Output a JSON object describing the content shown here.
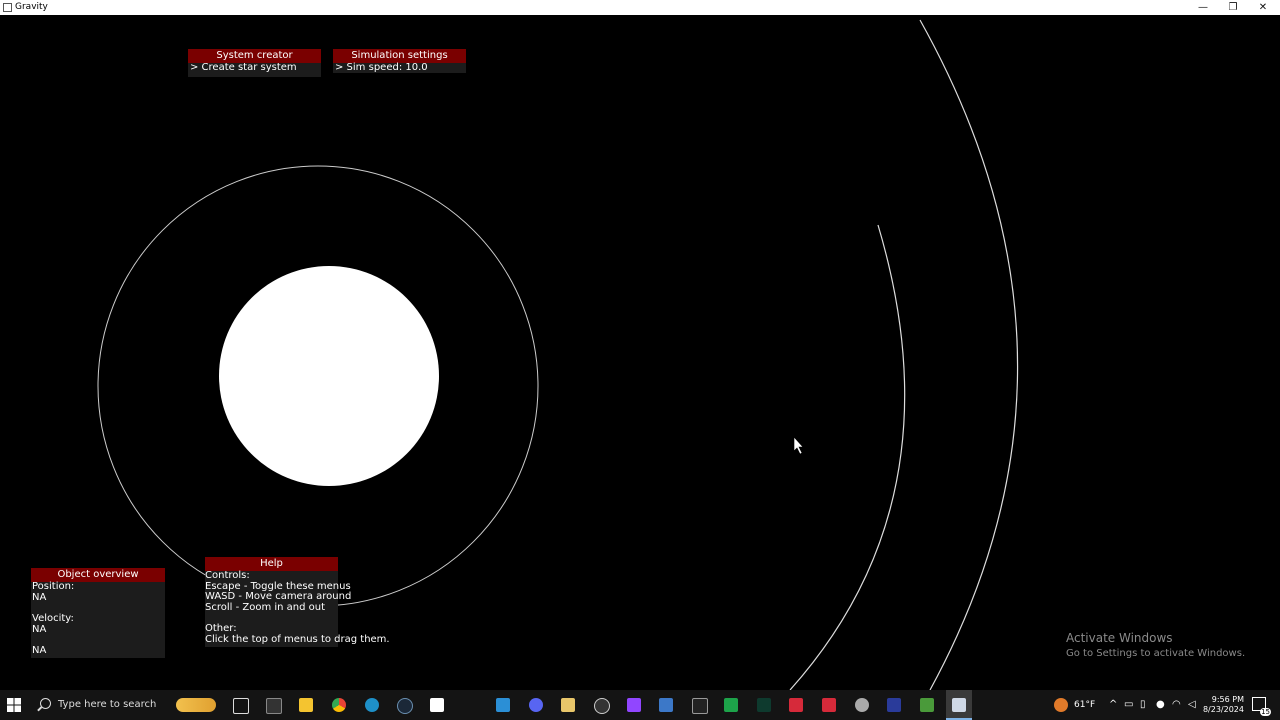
{
  "window": {
    "title": "Gravity",
    "minimize": "—",
    "restore": "❐",
    "close": "✕"
  },
  "menus": {
    "system_creator": {
      "title": "System creator",
      "items": [
        "> Create star system"
      ]
    },
    "simulation_settings": {
      "title": "Simulation settings",
      "items": [
        "> Sim speed: 10.0"
      ]
    },
    "object_overview": {
      "title": "Object overview",
      "position_label": "Position:",
      "position_value": "NA",
      "velocity_label": "Velocity:",
      "velocity_value": "NA",
      "extra_value": "NA"
    },
    "help": {
      "title": "Help",
      "lines": [
        "Controls:",
        "Escape - Toggle these menus",
        "WASD - Move camera around",
        "Scroll - Zoom in and out",
        "",
        "Other:",
        "Click the top of menus to drag them."
      ]
    }
  },
  "watermark": {
    "line1": "Activate Windows",
    "line2": "Go to Settings to activate Windows."
  },
  "taskbar": {
    "search_placeholder": "Type here to search",
    "icons": [
      "windows-start-icon",
      "search-icon",
      "banana-widget-icon",
      "task-view-icon",
      "terminal-icon",
      "file-explorer-icon",
      "chrome-icon",
      "edge-icon",
      "steam-icon",
      "notepad-icon",
      "vscode-icon",
      "discord-icon",
      "folder-icon",
      "obs-icon",
      "twitch-icon",
      "app-icon",
      "unity-icon",
      "textedit-icon",
      "audio-icon",
      "game-icon",
      "game-icon-2",
      "settings-icon",
      "jetbrains-icon",
      "minecraft-icon",
      "gravity-app-icon"
    ],
    "weather": "61°F",
    "time": "9:56 PM",
    "date": "8/23/2024",
    "notification_count": "15"
  }
}
